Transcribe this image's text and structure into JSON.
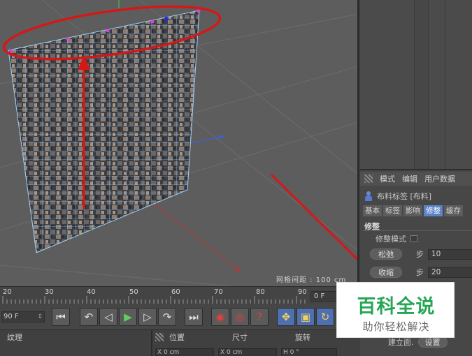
{
  "viewport": {
    "grid_spacing_label": "网格间距 : 100 cm"
  },
  "attributes": {
    "menu": [
      "模式",
      "编辑",
      "用户数据"
    ],
    "object_title": "布料标签 [布料]",
    "tabs": [
      "基本",
      "标签",
      "影响",
      "修整",
      "缓存"
    ],
    "active_tab": "修整",
    "section_title": "修整",
    "dress_mode_label": "修整模式",
    "relax_button": "松弛",
    "shrink_button": "收缩",
    "step_label": "步",
    "relax_steps": "10",
    "shrink_steps": "20",
    "bottom_label": "建立面.",
    "set_button": "设置"
  },
  "timeline": {
    "ticks": [
      "20",
      "30",
      "40",
      "50",
      "60",
      "70",
      "80",
      "90"
    ],
    "end_frame": "0 F"
  },
  "transport": {
    "current_frame": "90 F",
    "buttons": [
      {
        "name": "go-to-start-icon",
        "glyph": "⏮"
      },
      {
        "name": "prev-key-icon",
        "glyph": "↶"
      },
      {
        "name": "prev-frame-icon",
        "glyph": "◁"
      },
      {
        "name": "play-icon",
        "glyph": "▶"
      },
      {
        "name": "next-frame-icon",
        "glyph": "▷"
      },
      {
        "name": "next-key-icon",
        "glyph": "↷"
      },
      {
        "name": "go-to-end-icon",
        "glyph": "⏭"
      },
      {
        "name": "record-key-icon",
        "glyph": "◉"
      },
      {
        "name": "auto-key-icon",
        "glyph": "◎"
      },
      {
        "name": "keyframe-help-icon",
        "glyph": "?"
      },
      {
        "name": "move-tool-icon",
        "glyph": "✥"
      },
      {
        "name": "scale-tool-icon",
        "glyph": "▣"
      },
      {
        "name": "rotate-tool-icon",
        "glyph": "↻"
      }
    ]
  },
  "bottom_strip": {
    "texture_label": "纹理",
    "position_label": "位置",
    "size_label": "尺寸",
    "rotation_label": "旋转",
    "x_position": "X  0 cm",
    "x_size": "X  0 cm",
    "h_rotation": "H  0 °"
  },
  "watermark": {
    "title": "百科全说",
    "subtitle": "助你轻松解决"
  },
  "colors": {
    "annotation": "#d41818",
    "tab_active": "#5b82c8",
    "watermark_green": "#26a655"
  }
}
